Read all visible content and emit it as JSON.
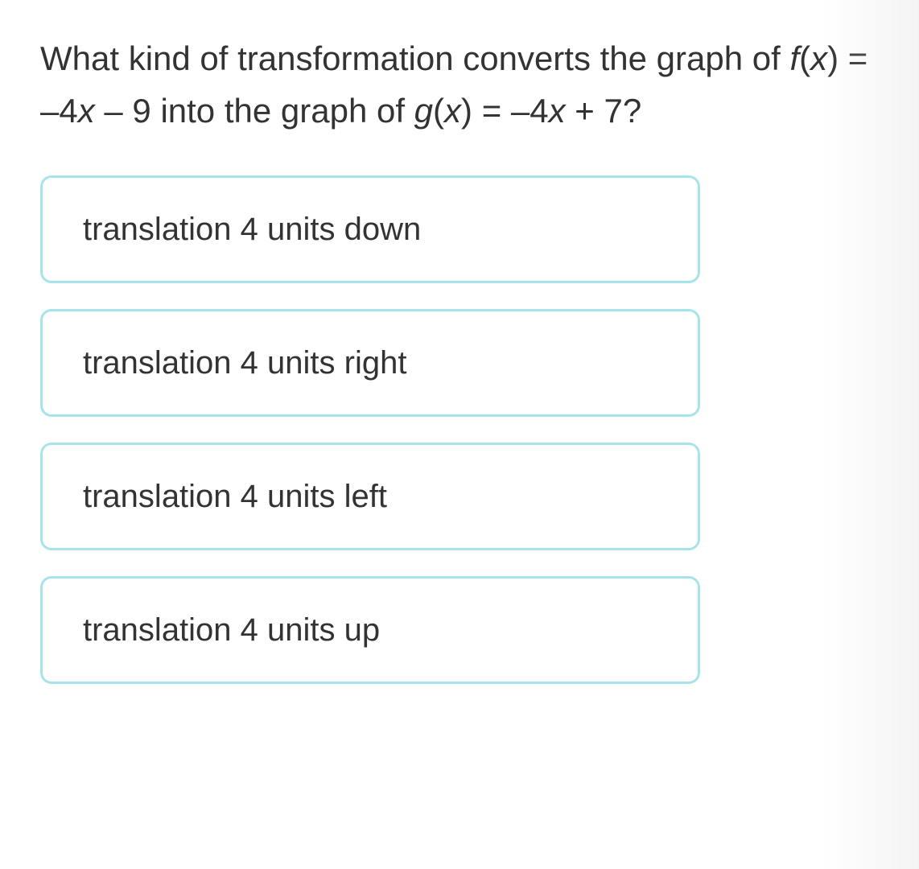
{
  "question": {
    "prefix": "What kind of transformation converts the graph of ",
    "f_name": "f",
    "var": "x",
    "f_expr": " = –4",
    "f_tail": " – 9 into the graph of ",
    "g_name": "g",
    "g_expr": " = –4",
    "g_tail": " + 7?"
  },
  "options": [
    {
      "label": "translation 4 units down"
    },
    {
      "label": "translation 4 units right"
    },
    {
      "label": "translation 4 units left"
    },
    {
      "label": "translation 4 units up"
    }
  ]
}
